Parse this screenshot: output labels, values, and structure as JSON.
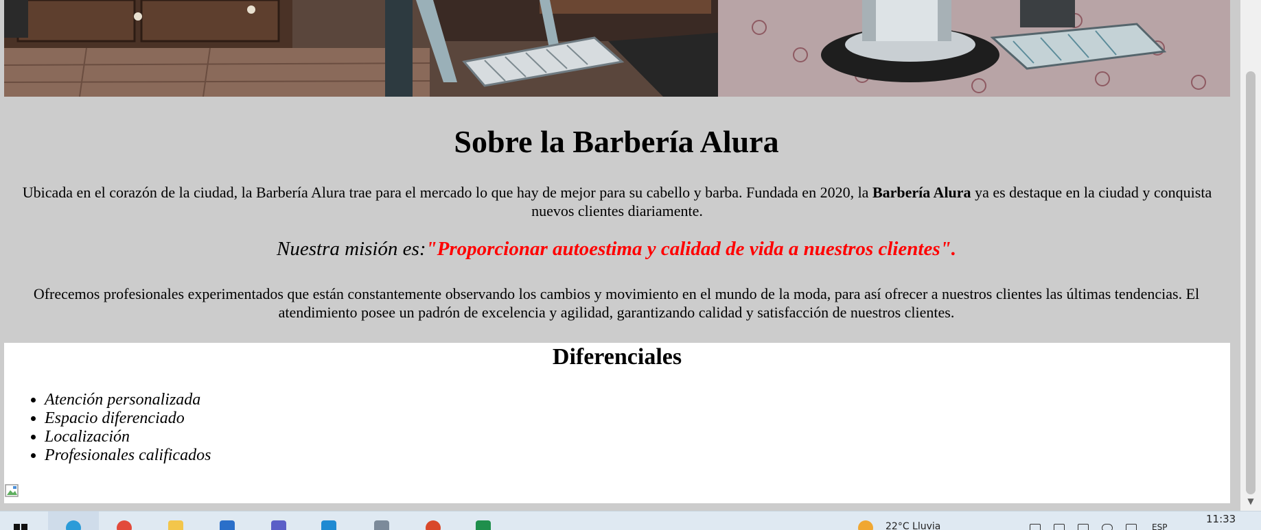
{
  "hero": {
    "image_alt": "barbershop-interior-photo"
  },
  "about": {
    "title": "Sobre la Barbería Alura",
    "p1_before": "Ubicada en el corazón de la ciudad, la Barbería Alura trae para el mercado lo que hay de mejor para su cabello y barba. Fundada en 2020, la ",
    "p1_bold": "Barbería Alura",
    "p1_after": " ya es destaque en la ciudad y conquista nuevos clientes diariamente.",
    "mission_label": "Nuestra misión es:",
    "mission_quote": "\"Proporcionar autoestima y calidad de vida a nuestros clientes\".",
    "p2": "Ofrecemos profesionales experimentados que están constantemente observando los cambios y movimiento en el mundo de la moda, para así ofrecer a nuestros clientes las últimas tendencias. El atendimiento posee un padrón de excelencia y agilidad, garantizando calidad y satisfacción de nuestros clientes."
  },
  "diferenciales": {
    "title": "Diferenciales",
    "items": [
      "Atención personalizada",
      "Espacio diferenciado",
      "Localización",
      "Profesionales calificados"
    ]
  },
  "taskbar": {
    "weather": "22°C  Lluvia",
    "time": "11:33",
    "lang": "ESP",
    "icons": [
      "windows-start-icon",
      "edge-icon",
      "chrome-icon",
      "file-explorer-icon",
      "mail-icon",
      "teams-icon",
      "vscode-icon",
      "calculator-icon",
      "office-icon",
      "excel-icon"
    ]
  },
  "colors": {
    "page_bg": "#cccccc",
    "mission_quote": "#ff0000",
    "section_bg": "#ffffff",
    "taskbar_bg": "#dfe9f2"
  }
}
